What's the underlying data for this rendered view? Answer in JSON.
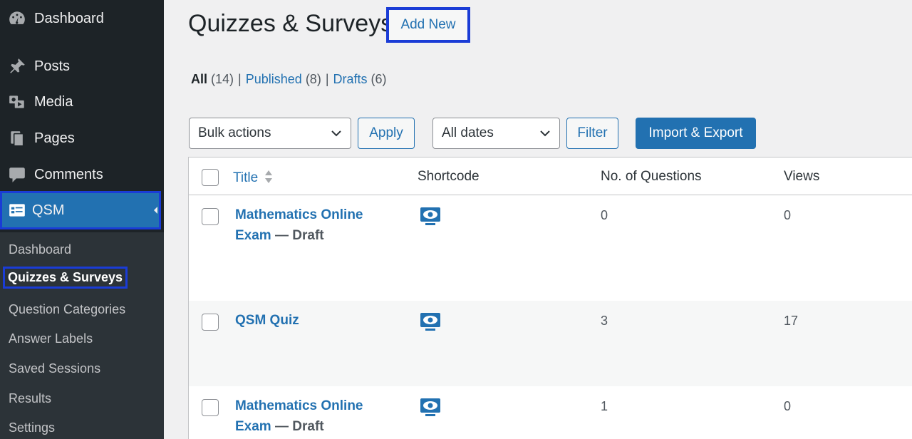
{
  "sidebar": {
    "menu": [
      {
        "label": "Dashboard",
        "icon": "dashboard-icon"
      },
      {
        "label": "Posts",
        "icon": "pin-icon"
      },
      {
        "label": "Media",
        "icon": "media-icon"
      },
      {
        "label": "Pages",
        "icon": "pages-icon"
      },
      {
        "label": "Comments",
        "icon": "comments-icon"
      },
      {
        "label": "QSM",
        "icon": "qsm-icon"
      }
    ],
    "submenu": [
      {
        "label": "Dashboard"
      },
      {
        "label": "Quizzes & Surveys"
      },
      {
        "label": "Question Categories"
      },
      {
        "label": "Answer Labels"
      },
      {
        "label": "Saved Sessions"
      },
      {
        "label": "Results"
      },
      {
        "label": "Settings"
      }
    ]
  },
  "header": {
    "title": "Quizzes & Surveys",
    "add_new": "Add New"
  },
  "views": {
    "all": "All",
    "all_count": "(14)",
    "published": "Published",
    "published_count": "(8)",
    "drafts": "Drafts",
    "drafts_count": "(6)",
    "separator": "|"
  },
  "controls": {
    "bulk_actions": "Bulk actions",
    "apply": "Apply",
    "all_dates": "All dates",
    "filter": "Filter",
    "import_export": "Import & Export"
  },
  "table": {
    "columns": {
      "title": "Title",
      "shortcode": "Shortcode",
      "questions": "No. of Questions",
      "views": "Views"
    },
    "rows": [
      {
        "title_line1": "Mathematics Online",
        "title_line2": "Exam",
        "state": " — Draft",
        "questions": "0",
        "views": "0"
      },
      {
        "title_line1": "QSM Quiz",
        "title_line2": "",
        "state": "",
        "questions": "3",
        "views": "17"
      },
      {
        "title_line1": "Mathematics Online",
        "title_line2": "Exam",
        "state": " — Draft",
        "questions": "1",
        "views": "0"
      }
    ]
  },
  "colors": {
    "accent": "#2271b1",
    "sidebar": "#1d2327",
    "highlight": "#1a3cd6"
  }
}
